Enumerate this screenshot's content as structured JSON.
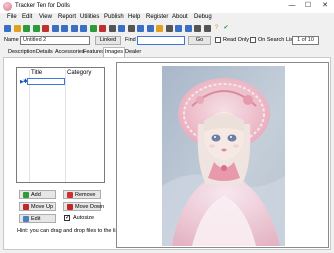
{
  "window": {
    "title": "Tracker Ten for Dolls",
    "controls": [
      "—",
      "☐",
      "✕"
    ]
  },
  "menu": [
    "File",
    "Edit",
    "View",
    "Report",
    "Utilities",
    "Publish",
    "Help",
    "Register",
    "About",
    "Debug"
  ],
  "toolbar_icons": [
    "save-icon",
    "open-icon",
    "back-icon",
    "forward-icon",
    "record-icon",
    "first-icon",
    "prev-icon",
    "next-icon",
    "last-icon",
    "add-icon",
    "delete-icon",
    "search-icon",
    "filter-icon",
    "sort-icon",
    "grid-icon",
    "list-icon",
    "report-icon",
    "print-icon",
    "import-icon",
    "export-icon",
    "settings-icon",
    "tools-icon",
    "help-icon",
    "check-icon"
  ],
  "record": {
    "name_label": "Name",
    "name_value": "Untitled 2",
    "linked_label": "Linked",
    "find_label": "Find",
    "find_value": "",
    "go_label": "Go",
    "read_only_label": "Read Only",
    "on_search_list_label": "On Search List",
    "record_counter": "1 of 10"
  },
  "tabs": [
    "Description",
    "Details",
    "Accessories",
    "Features",
    "Images",
    "Dealer"
  ],
  "active_tab": "Images",
  "images_list": {
    "columns": [
      "Title",
      "Category"
    ],
    "rows": [
      {
        "title": "",
        "category": ""
      }
    ]
  },
  "buttons": {
    "add": "Add",
    "remove": "Remove",
    "move_up": "Move Up",
    "move_down": "Move Down",
    "edit": "Edit",
    "autosize": "Autosize"
  },
  "autosize_checked": true,
  "hint": "Hint: you can drag and drop files to the list.",
  "colors": {
    "accent": "#3c78d8",
    "add": "#2e9b3a",
    "remove": "#d03030",
    "move": "#c02828",
    "check": "#2e9b3a"
  }
}
